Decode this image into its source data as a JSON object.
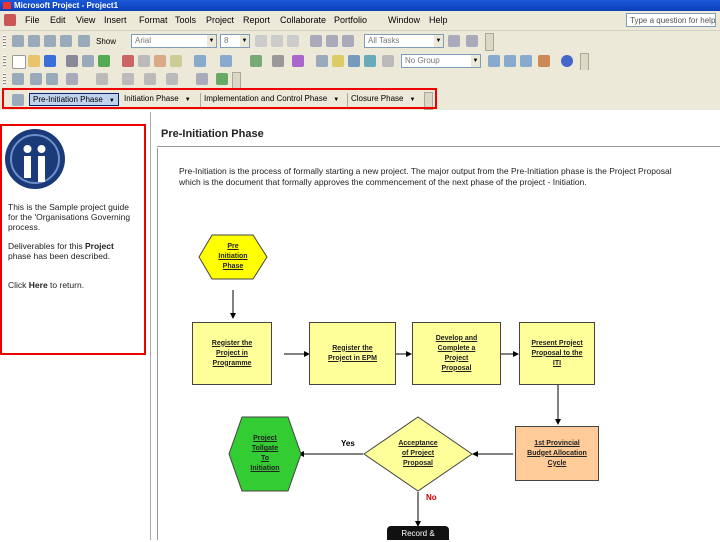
{
  "window": {
    "title": "Microsoft Project - Project1"
  },
  "menu": {
    "items": [
      "File",
      "Edit",
      "View",
      "Insert",
      "Format",
      "Tools",
      "Project",
      "Report",
      "Collaborate",
      "Portfolio",
      "Window",
      "Help"
    ],
    "help_placeholder": "Type a question for help"
  },
  "toolbar_formatting": {
    "show_label": "Show",
    "font": "Arial",
    "size": "8",
    "filter": "All Tasks"
  },
  "toolbar_standard": {
    "group": "No Group"
  },
  "phase_bar": {
    "phases": [
      "Pre-Initiation Phase",
      "Initiation Phase",
      "Implementation and Control Phase",
      "Closure Phase"
    ],
    "active_index": 0
  },
  "side_pane": {
    "p1": "This is the Sample project guide for the 'Organisations Governing process.",
    "p2_before": "Deliverables for this ",
    "p2_bold": "Project",
    "p2_after": " phase has been described.",
    "p3_before": "Click ",
    "p3_bold": "Here",
    "p3_after": " to return."
  },
  "main": {
    "title": "Pre-Initiation Phase",
    "intro_line1": "Pre-Initiation is the process of formally starting a new project. The major output from the Pre-Initiation phase is the Project Proposal",
    "intro_line2": "which is the document that formally approves the commencement of the next phase of the project - Initiation."
  },
  "flowchart": {
    "start": [
      "Pre",
      "Initiation",
      "Phase"
    ],
    "box1": [
      "Register the",
      "Project in",
      "Programme"
    ],
    "box2": [
      "Register the",
      "Project in EPM"
    ],
    "box3": [
      "Develop and",
      "Complete a",
      "Project",
      "Proposal"
    ],
    "box4": [
      "Present Project",
      "Proposal to the",
      "ITI"
    ],
    "box5": [
      "1st Provincial",
      "Budget Allocation",
      "Cycle"
    ],
    "decision": [
      "Acceptance",
      "of Project",
      "Proposal"
    ],
    "end": [
      "Project",
      "Tollgate",
      "To",
      "Initiation"
    ],
    "yes_label": "Yes",
    "no_label": "No",
    "record_button": "Record &"
  },
  "colors": {
    "highlight_red": "#e00000",
    "yellow": "#ffff00",
    "green": "#33cc33",
    "peach": "#ffcc99"
  }
}
